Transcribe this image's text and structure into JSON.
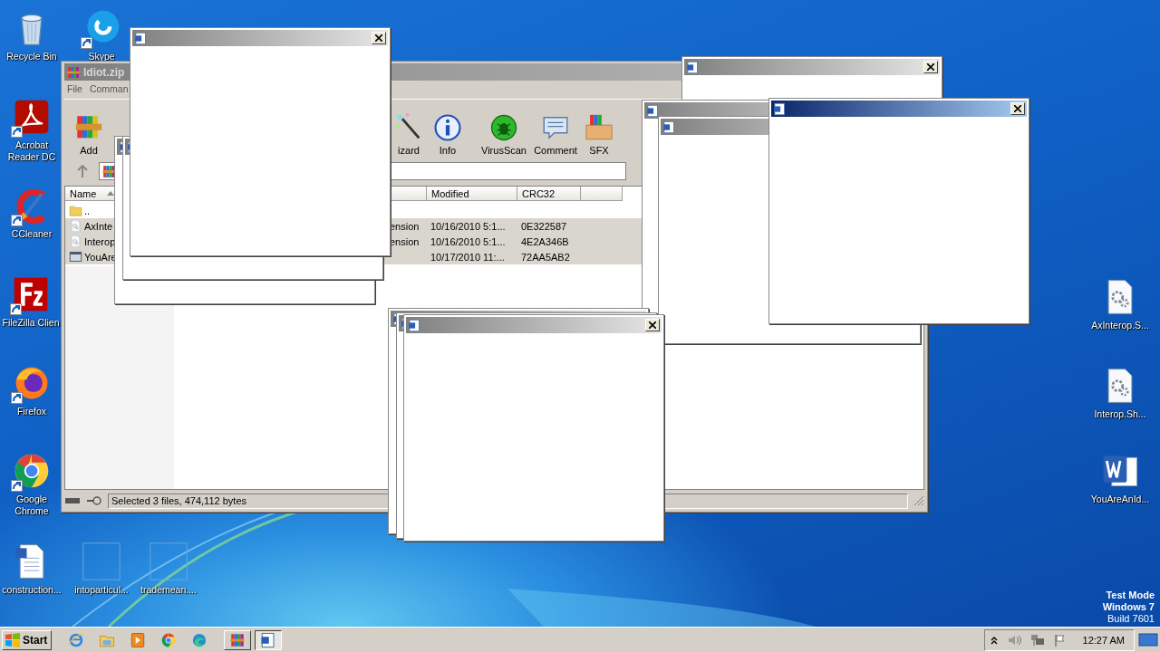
{
  "desktop_icons": [
    {
      "label": "Recycle Bin",
      "kind": "recycle",
      "shortcut": false
    },
    {
      "label": "Skype",
      "kind": "skype",
      "shortcut": true
    },
    {
      "label": "Acrobat Reader DC",
      "kind": "acrobat",
      "shortcut": true
    },
    {
      "label": "CCleaner",
      "kind": "ccleaner",
      "shortcut": true
    },
    {
      "label": "FileZilla Clien",
      "kind": "filezilla",
      "shortcut": true
    },
    {
      "label": "Firefox",
      "kind": "firefox",
      "shortcut": true
    },
    {
      "label": "Google Chrome",
      "kind": "chrome",
      "shortcut": true
    },
    {
      "label": "construction...",
      "kind": "worddoc",
      "shortcut": false
    },
    {
      "label": "intoparticul...",
      "kind": "blank",
      "shortcut": false
    },
    {
      "label": "trademean....",
      "kind": "blank",
      "shortcut": false
    },
    {
      "label": "AxInterop.S...",
      "kind": "config",
      "shortcut": false
    },
    {
      "label": "Interop.Sh...",
      "kind": "config",
      "shortcut": false
    },
    {
      "label": "YouAreAnId...",
      "kind": "word",
      "shortcut": false
    }
  ],
  "archive_window": {
    "title": "Idiot.zip",
    "menu": [
      "File",
      "Comman"
    ],
    "toolbar": [
      {
        "label": "Add",
        "kind": "add"
      },
      {
        "label": "izard",
        "kind": "wizard"
      },
      {
        "label": "Info",
        "kind": "info"
      },
      {
        "label": "VirusScan",
        "kind": "virusscan"
      },
      {
        "label": "Comment",
        "kind": "comment"
      },
      {
        "label": "SFX",
        "kind": "sfx"
      }
    ],
    "columns": [
      "Name",
      "Modified",
      "CRC32"
    ],
    "rows": [
      {
        "name": "..",
        "kind": "folder",
        "selected": false
      },
      {
        "name": "AxInte",
        "kind": "config",
        "selected": true,
        "type": "ension",
        "modified": "10/16/2010 5:1...",
        "crc32": "0E322587"
      },
      {
        "name": "Interop",
        "kind": "config",
        "selected": true,
        "type": "ension",
        "modified": "10/16/2010 5:1...",
        "crc32": "4E2A346B"
      },
      {
        "name": "YouAre",
        "kind": "app",
        "selected": true,
        "modified": "10/17/2010 11:...",
        "crc32": "72AA5AB2"
      }
    ],
    "status": "Selected 3 files, 474,112 bytes"
  },
  "popups": [
    {
      "active": false
    },
    {
      "active": false
    },
    {
      "active": false
    },
    {
      "active": true
    },
    {
      "active": false
    },
    {
      "active": false
    },
    {
      "active": false
    },
    {
      "active": false
    },
    {
      "active": false
    },
    {
      "active": false
    }
  ],
  "os_notice": [
    "Test Mode",
    "Windows 7",
    "Build 7601"
  ],
  "taskbar": {
    "start": "Start",
    "quick_launch": [
      {
        "kind": "ie"
      },
      {
        "kind": "explorer"
      },
      {
        "kind": "media"
      },
      {
        "kind": "chrome"
      },
      {
        "kind": "edge"
      }
    ],
    "tasks": [
      {
        "kind": "winrar",
        "selected": false
      },
      {
        "kind": "word",
        "selected": true
      }
    ],
    "clock": "12:27 AM"
  }
}
